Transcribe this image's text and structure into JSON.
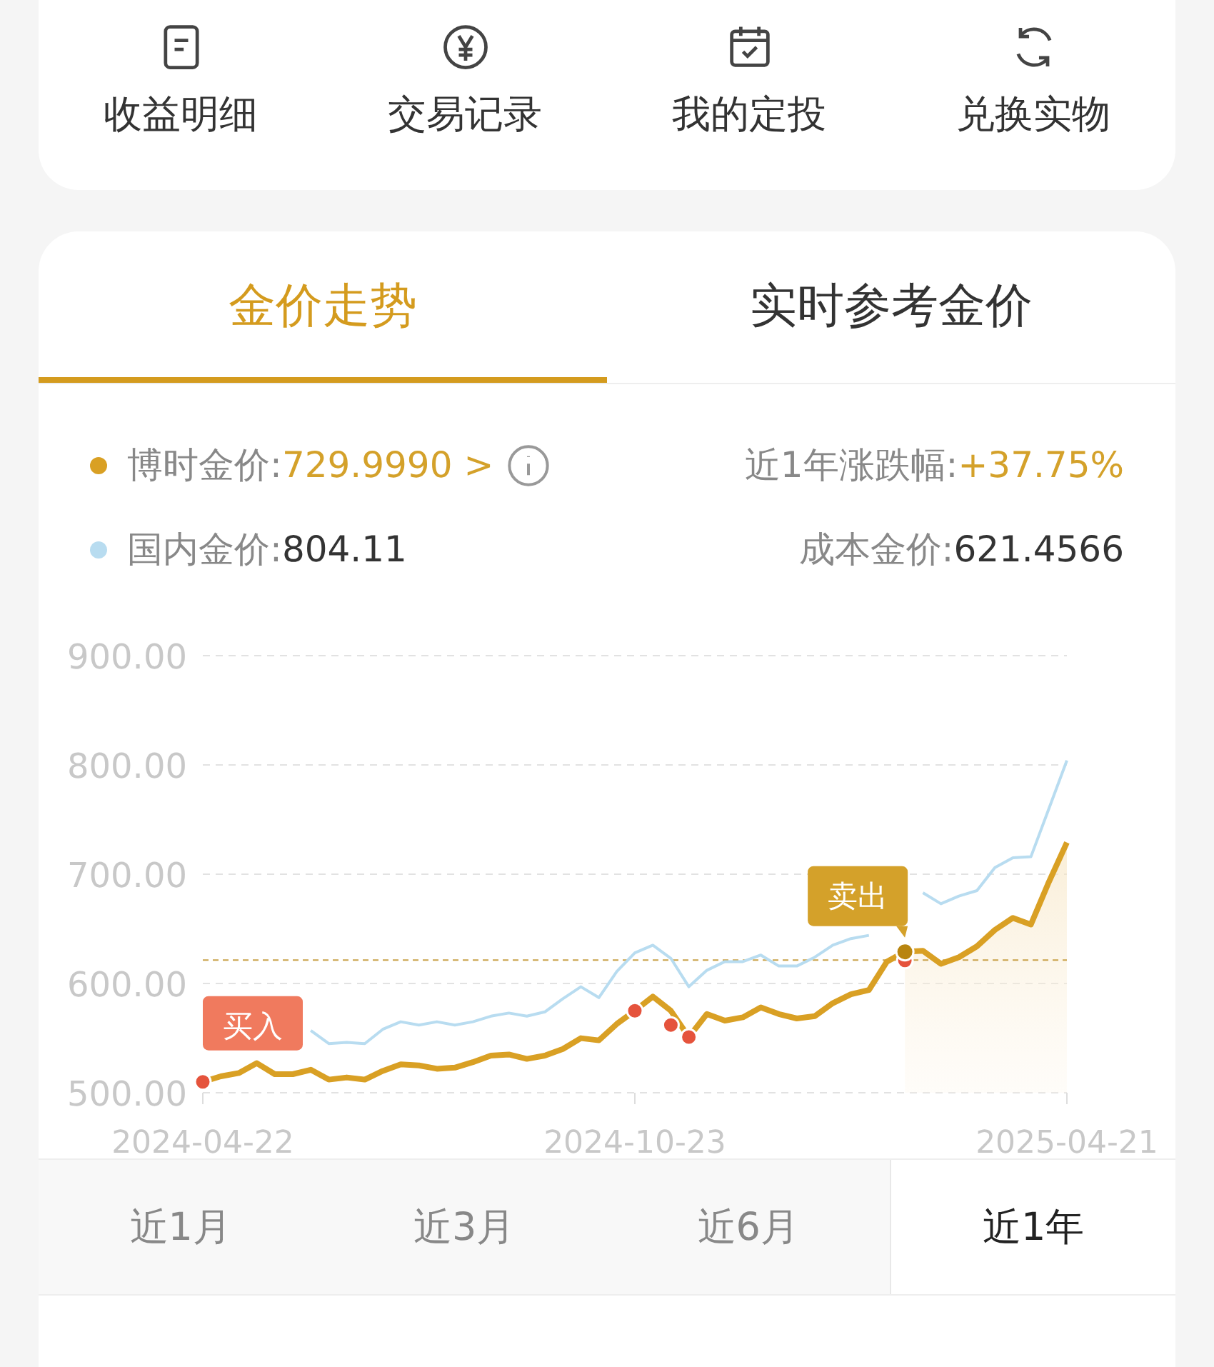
{
  "shortcuts": [
    {
      "label": "收益明细",
      "kind": "document"
    },
    {
      "label": "交易记录",
      "kind": "yen"
    },
    {
      "label": "我的定投",
      "kind": "calendar"
    },
    {
      "label": "兑换实物",
      "kind": "exchange"
    }
  ],
  "tabs": [
    {
      "label": "金价走势",
      "selected": true
    },
    {
      "label": "实时参考金价",
      "selected": false
    }
  ],
  "legend": [
    {
      "value": "729.9990",
      "accent": true,
      "more": ">",
      "info": true
    },
    {
      "value": "804.11",
      "accent": false
    }
  ],
  "stats": [
    {
      "label": "近1年涨跌幅:",
      "value": "+37.75%",
      "accent": true
    },
    {
      "label": "成本金价:",
      "value": "621.4566",
      "accent": false
    }
  ],
  "chart_data": {
    "type": "line",
    "grid": true,
    "categories": [
      "2024-04-22",
      null,
      null,
      null,
      null,
      null,
      null,
      null,
      null,
      null,
      null,
      null,
      null,
      null,
      null,
      null,
      null,
      null,
      null,
      null,
      null,
      null,
      null,
      null,
      "2024-10-23",
      null,
      null,
      null,
      null,
      null,
      null,
      null,
      null,
      null,
      null,
      null,
      null,
      null,
      null,
      null,
      null,
      null,
      null,
      null,
      null,
      null,
      null,
      null,
      "2025-04-21"
    ],
    "series": [
      {
        "name": "博时金价:",
        "color": "#d9a024",
        "values": [
          510,
          515,
          518,
          527,
          517,
          517,
          521,
          512,
          514,
          512,
          520,
          526,
          525,
          522,
          523,
          528,
          534,
          535,
          531,
          534,
          540,
          550,
          548,
          563,
          575,
          588,
          575,
          551,
          572,
          566,
          569,
          578,
          572,
          568,
          570,
          582,
          590,
          594,
          620,
          629,
          630,
          618,
          624,
          634,
          649,
          660,
          654,
          693,
          729
        ]
      },
      {
        "name": "国内金价:",
        "color": "#b8dcf0",
        "values": [
          null,
          null,
          null,
          null,
          null,
          null,
          557,
          545,
          546,
          545,
          558,
          565,
          562,
          565,
          562,
          565,
          570,
          573,
          570,
          574,
          586,
          597,
          587,
          611,
          628,
          635,
          623,
          597,
          612,
          620,
          620,
          626,
          616,
          616,
          624,
          635,
          641,
          644,
          null,
          null,
          683,
          673,
          680,
          685,
          706,
          715,
          716,
          760,
          804
        ]
      },
      {
        "type": "scatter",
        "color": "#e5533c",
        "values": [
          510,
          null,
          null,
          null,
          null,
          null,
          null,
          null,
          null,
          null,
          null,
          null,
          null,
          null,
          null,
          null,
          null,
          null,
          null,
          null,
          null,
          null,
          null,
          null,
          575,
          null,
          562,
          551,
          null,
          null,
          null,
          null,
          null,
          null,
          null,
          null,
          null,
          null,
          null,
          621,
          null,
          null,
          null,
          null,
          null,
          null,
          null,
          null,
          null
        ]
      }
    ],
    "ylim": [
      500,
      900
    ],
    "yticks": [
      {
        "value": 500,
        "label": "500.00"
      },
      {
        "value": 600,
        "label": "600.00"
      },
      {
        "value": 700,
        "label": "700.00"
      },
      {
        "value": 800,
        "label": "800.00"
      },
      {
        "value": 900,
        "label": "900.00"
      }
    ],
    "ref_lines": [
      {
        "axis": "y",
        "value": 621.4566
      }
    ],
    "annotations": [
      {
        "text": "买入",
        "x": "2024-04-22",
        "y": 510
      },
      {
        "text": "卖出"
      }
    ]
  },
  "periods": [
    {
      "label": "近1月",
      "selected": false
    },
    {
      "label": "近3月",
      "selected": false
    },
    {
      "label": "近6月",
      "selected": false
    },
    {
      "label": "近1年",
      "selected": true
    }
  ]
}
